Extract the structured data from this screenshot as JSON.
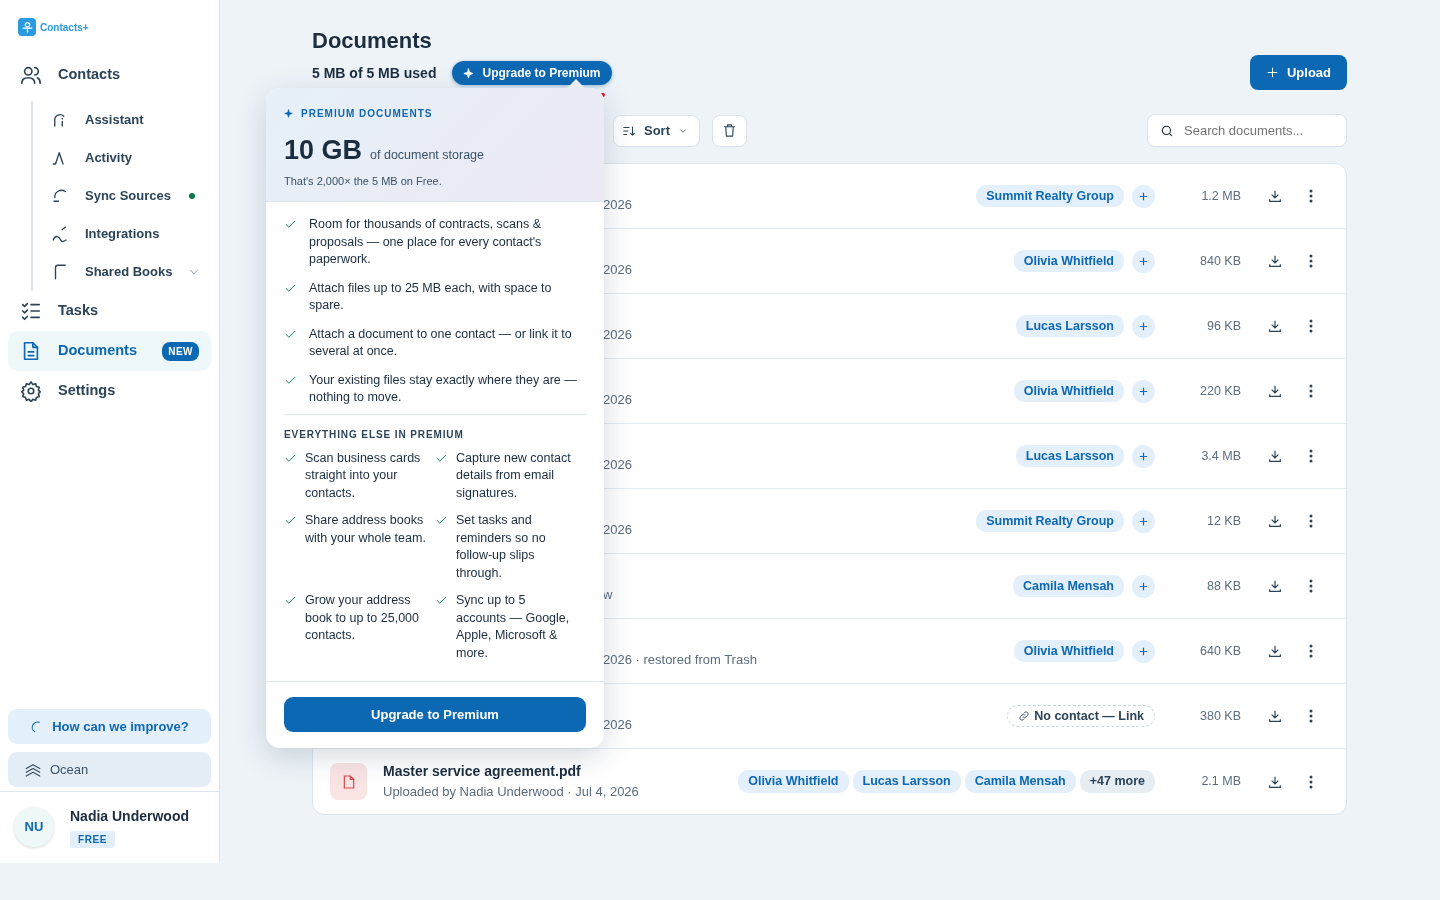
{
  "app": {
    "name": "Contacts+"
  },
  "nav": [
    {
      "label": "Contacts",
      "selected": false,
      "children": [
        {
          "label": "Assistant",
          "dot": false
        },
        {
          "label": "Activity",
          "dot": false
        },
        {
          "label": "Sync Sources",
          "dot": true
        },
        {
          "label": "Integrations",
          "dot": false
        },
        {
          "label": "Shared Books",
          "dot": false,
          "expanded": false
        }
      ]
    },
    {
      "label": "Tasks",
      "selected": false
    },
    {
      "label": "Documents",
      "selected": true,
      "badge": "NEW"
    },
    {
      "label": "Settings",
      "selected": false
    }
  ],
  "feedback": "How can we improve?",
  "theme": "Ocean",
  "user": {
    "initials": "NU",
    "name": "Nadia Underwood",
    "plan": "FREE"
  },
  "header": {
    "title": "Documents",
    "usage": "5 MB of 5 MB used",
    "level": 1,
    "upgrade": "Upgrade to Premium",
    "upload": "Upload"
  },
  "toolbar": {
    "sort": "Sort",
    "search_placeholder": "Search documents..."
  },
  "rows": [
    {
      "note": "2026",
      "contacts": [
        "Summit Realty Group"
      ],
      "size": "1.2 MB"
    },
    {
      "note": "2026",
      "contacts": [
        "Olivia Whitfield"
      ],
      "size": "840 KB"
    },
    {
      "note": "2026",
      "contacts": [
        "Lucas Larsson"
      ],
      "size": "96 KB"
    },
    {
      "note": "2026",
      "contacts": [
        "Olivia Whitfield"
      ],
      "size": "220 KB"
    },
    {
      "note": "2026",
      "contacts": [
        "Lucas Larsson"
      ],
      "size": "3.4 MB"
    },
    {
      "note": "2026",
      "contacts": [
        "Summit Realty Group"
      ],
      "size": "12 KB"
    },
    {
      "note": "w",
      "contacts": [
        "Camila Mensah"
      ],
      "size": "88 KB"
    },
    {
      "note": "2026 · restored from Trash",
      "contacts": [
        "Olivia Whitfield"
      ],
      "size": "640 KB"
    },
    {
      "note": "2026",
      "link": "No contact — Link",
      "size": "380 KB"
    },
    {
      "name": "Master service agreement.pdf",
      "note": "Uploaded by Nadia Underwood · Jul 4, 2026",
      "contacts": [
        "Olivia Whitfield",
        "Lucas Larsson",
        "Camila Mensah"
      ],
      "more": "+47 more",
      "size": "2.1 MB"
    }
  ],
  "popover": {
    "eyebrow": "PREMIUM DOCUMENTS",
    "big": "10 GB",
    "big_suffix": "of document storage",
    "sub": "That's 2,000× the 5 MB on Free.",
    "features": [
      "Room for thousands of contracts, scans & proposals — one place for every contact's paperwork.",
      "Attach files up to 25 MB each, with space to spare.",
      "Attach a document to one contact — or link it to several at once.",
      "Your existing files stay exactly where they are — nothing to move."
    ],
    "section": "EVERYTHING ELSE IN PREMIUM",
    "extras": [
      "Scan business cards straight into your contacts.",
      "Capture new contact details from email signatures.",
      "Share address books with your whole team.",
      "Set tasks and reminders so no follow-up slips through.",
      "Grow your address book to up to 25,000 contacts.",
      "Sync up to 5 accounts — Google, Apple, Microsoft & more."
    ],
    "button": "Upgrade to Premium"
  }
}
